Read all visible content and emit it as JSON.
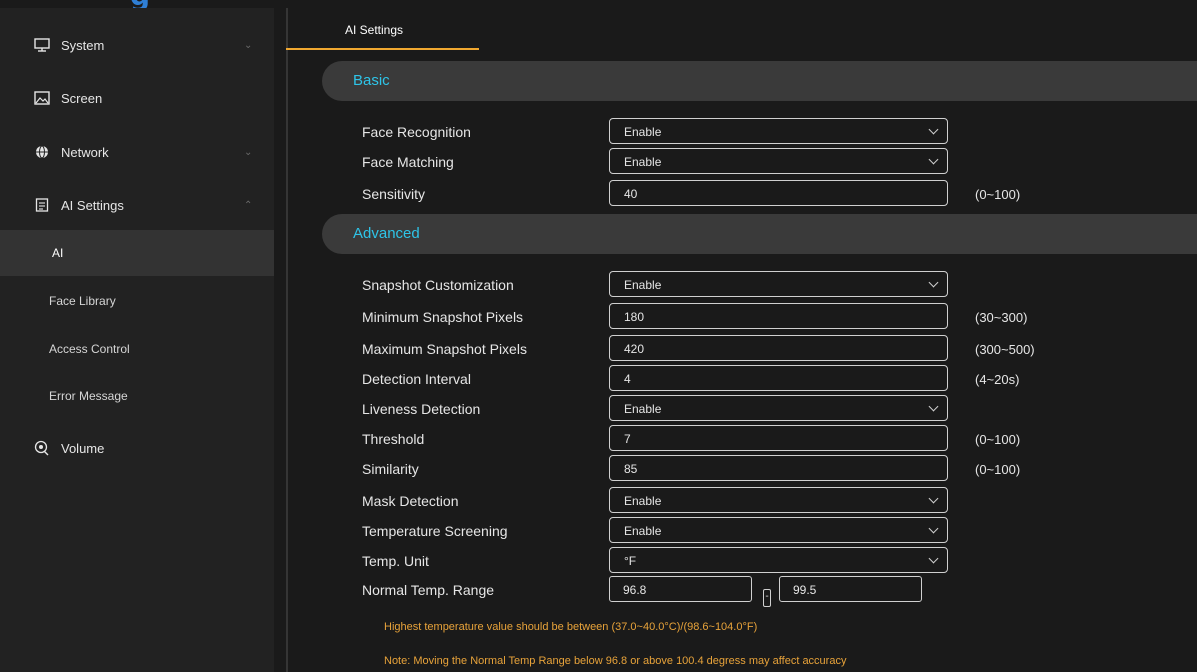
{
  "sidebar": {
    "items": [
      {
        "label": "System",
        "icon": "monitor-icon",
        "chevron": "chevron-down"
      },
      {
        "label": "Screen",
        "icon": "image-icon",
        "chevron": ""
      },
      {
        "label": "Network",
        "icon": "globe-icon",
        "chevron": "chevron-down"
      },
      {
        "label": "AI Settings",
        "icon": "document-icon",
        "chevron": "chevron-up"
      },
      {
        "label": "Volume",
        "icon": "volume-icon",
        "chevron": ""
      }
    ],
    "subitems": [
      {
        "label": "AI",
        "active": true
      },
      {
        "label": "Face Library",
        "active": false
      },
      {
        "label": "Access Control",
        "active": false
      },
      {
        "label": "Error Message",
        "active": false
      }
    ]
  },
  "tab": {
    "label": "AI Settings"
  },
  "sections": {
    "basic": "Basic",
    "advanced": "Advanced"
  },
  "basic": [
    {
      "label": "Face Recognition",
      "type": "select",
      "value": "Enable"
    },
    {
      "label": "Face Matching",
      "type": "select",
      "value": "Enable"
    },
    {
      "label": "Sensitivity",
      "type": "input",
      "value": "40",
      "range": "(0~100)"
    }
  ],
  "advanced": [
    {
      "label": "Snapshot Customization",
      "type": "select",
      "value": "Enable"
    },
    {
      "label": "Minimum Snapshot Pixels",
      "type": "input",
      "value": "180",
      "range": "(30~300)"
    },
    {
      "label": "Maximum Snapshot Pixels",
      "type": "input",
      "value": "420",
      "range": "(300~500)"
    },
    {
      "label": "Detection Interval",
      "type": "input",
      "value": "4",
      "range": "(4~20s)"
    },
    {
      "label": "Liveness Detection",
      "type": "select",
      "value": "Enable"
    },
    {
      "label": "Threshold",
      "type": "input",
      "value": "7",
      "range": "(0~100)"
    },
    {
      "label": "Similarity",
      "type": "input",
      "value": "85",
      "range": "(0~100)"
    },
    {
      "label": "Mask Detection",
      "type": "select",
      "value": "Enable"
    },
    {
      "label": "Temperature Screening",
      "type": "select",
      "value": "Enable"
    },
    {
      "label": "Temp. Unit",
      "type": "select",
      "value": "°F"
    }
  ],
  "temp_range": {
    "label": "Normal Temp. Range",
    "min": "96.8",
    "max": "99.5",
    "separator": "-"
  },
  "notes": [
    "Highest temperature value should be between (37.0~40.0°C)/(98.6~104.0°F)",
    "Note: Moving the Normal Temp Range below 96.8 or above 100.4 degress may affect accuracy"
  ],
  "colors": {
    "accent": "#f0a830",
    "section_title": "#2ec4e8",
    "note": "#e8a33a"
  }
}
